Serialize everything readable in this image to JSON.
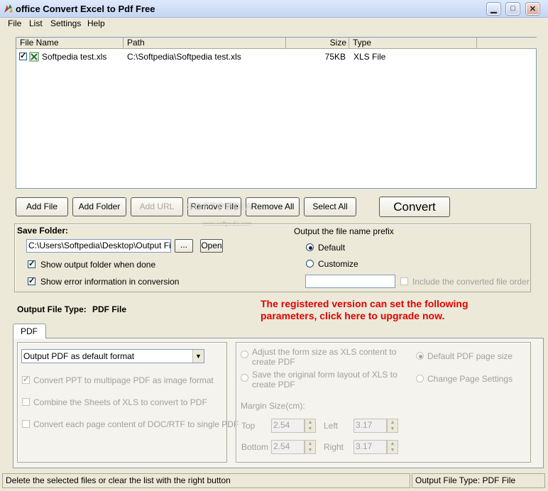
{
  "window": {
    "title": "office Convert Excel to Pdf Free"
  },
  "menu": [
    "File",
    "List",
    "Settings",
    "Help"
  ],
  "file_list": {
    "columns": [
      "File Name",
      "Path",
      "Size",
      "Type"
    ],
    "rows": [
      {
        "checked": true,
        "name": "Softpedia test.xls",
        "path": "C:\\Softpedia\\Softpedia test.xls",
        "size": "75KB",
        "type": "XLS File"
      }
    ]
  },
  "buttons": {
    "add_file": "Add File",
    "add_folder": "Add Folder",
    "add_url": "Add URL",
    "remove_file": "Remove File",
    "remove_all": "Remove All",
    "select_all": "Select All",
    "convert": "Convert",
    "browse": "...",
    "open": "Open"
  },
  "save_folder": {
    "label": "Save Folder:",
    "path": "C:\\Users\\Softpedia\\Desktop\\Output Files",
    "show_output": "Show output folder when done",
    "show_error": "Show error information in conversion"
  },
  "prefix": {
    "label": "Output the file name prefix",
    "default": "Default",
    "customize": "Customize",
    "include_order": "Include the converted file order"
  },
  "output_type": {
    "label": "Output File Type:",
    "value": "PDF File"
  },
  "notice": {
    "line1": "The registered version can set the following",
    "line2": "parameters, click here to upgrade now."
  },
  "tab": {
    "label": "PDF"
  },
  "pdf_options": {
    "format_select": "Output PDF as default format",
    "ppt_multipage": "Convert PPT to multipage PDF as image format",
    "combine_sheets": "Combine the Sheets of XLS to convert to PDF",
    "each_page": "Convert each page content of DOC/RTF to single PDF"
  },
  "page_options": {
    "adjust_line1": "Adjust the form size as XLS content to",
    "adjust_line2": "create PDF",
    "save_line1": "Save the original form layout of XLS to",
    "save_line2": "create PDF",
    "default_size": "Default PDF page size",
    "change_settings": "Change Page Settings",
    "margin_label": "Margin Size(cm):",
    "top_label": "Top",
    "top_value": "2.54",
    "left_label": "Left",
    "left_value": "3.17",
    "bottom_label": "Bottom",
    "bottom_value": "2.54",
    "right_label": "Right",
    "right_value": "3.17"
  },
  "watermark": "SOFTPEDIA",
  "watermark_url": "www.softpedia.com",
  "status": {
    "left": "Delete the selected files or clear the list with the right button",
    "right": "Output File Type:  PDF File"
  }
}
